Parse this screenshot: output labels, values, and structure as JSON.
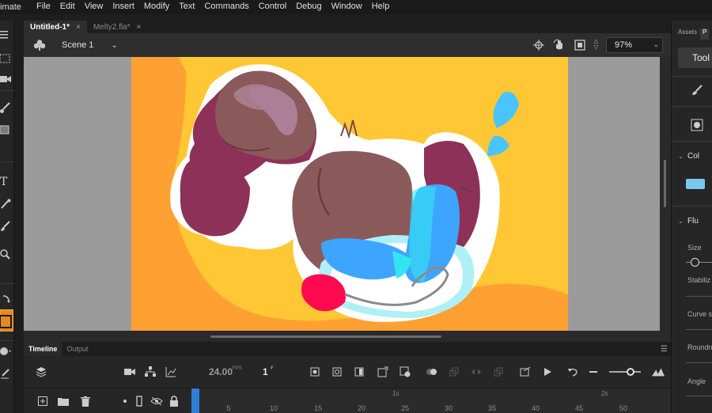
{
  "app": {
    "name": "imate",
    "menus": [
      "File",
      "Edit",
      "View",
      "Insert",
      "Modify",
      "Text",
      "Commands",
      "Control",
      "Debug",
      "Window",
      "Help"
    ]
  },
  "doc_tabs": [
    {
      "label": "Untitled-1*",
      "close": "×",
      "active": true
    },
    {
      "label": "Melty2.fla*",
      "close": "×",
      "active": false
    }
  ],
  "edit_bar": {
    "scene_label": "Scene 1",
    "zoom": "97%"
  },
  "timeline": {
    "tabs": [
      "Timeline",
      "Output"
    ],
    "fps_value": "24.00",
    "fps_unit": "FPS",
    "current_frame": "1",
    "frame_unit": "F",
    "second_markers": [
      "1s",
      "2s"
    ],
    "frame_ticks": [
      "5",
      "10",
      "15",
      "20",
      "25",
      "30",
      "35",
      "40",
      "45",
      "50"
    ]
  },
  "right_panel": {
    "tabs": [
      "Assets",
      "P"
    ],
    "tool_button": "Tool",
    "sections": {
      "color": "Col",
      "fluid": "Flu"
    },
    "labels": {
      "size": "Size",
      "stabilizer": "Stabiliz",
      "curve": "Curve s",
      "roundness": "Roundne",
      "angle": "Angle"
    },
    "fill_color": "#78c8f0"
  },
  "colors": {
    "stage_bg": "#ffa033",
    "stroke_swatch": "#e48a20",
    "playhead": "#2f7ed8"
  }
}
